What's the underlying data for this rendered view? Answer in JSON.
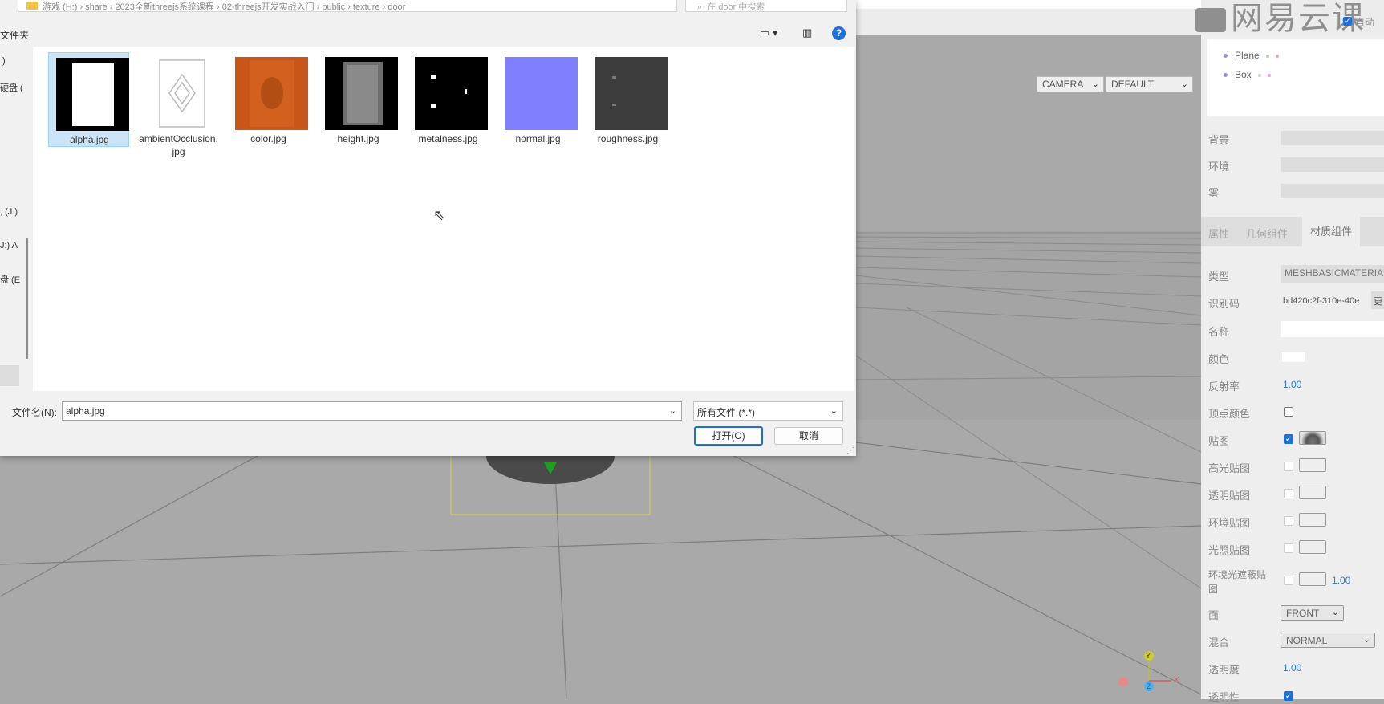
{
  "page": {
    "logo_text": "网易云课堂",
    "auto_update_label": "自动"
  },
  "viewport": {
    "camera_select": "CAMERA",
    "shading_select": "DEFAULT",
    "axis_labels": {
      "x": "X",
      "y": "Y",
      "z": "Z"
    }
  },
  "outliner": {
    "items": [
      {
        "label": "Plane"
      },
      {
        "label": "Box"
      }
    ]
  },
  "scene": {
    "background_label": "背景",
    "environment_label": "环境",
    "fog_label": "雾"
  },
  "tabs": {
    "properties": "属性",
    "geometry": "几何组件",
    "material": "材质组件"
  },
  "material": {
    "type_label": "类型",
    "type_value": "MESHBASICMATERIA",
    "uuid_label": "识别码",
    "uuid_value": "bd420c2f-310e-40e",
    "uuid_button": "更",
    "name_label": "名称",
    "color_label": "颜色",
    "color_value": "#ffffff",
    "reflectivity_label": "反射率",
    "reflectivity_value": "1.00",
    "vertex_colors_label": "顶点颜色",
    "map_label": "贴图",
    "specular_map_label": "高光贴图",
    "alpha_map_label": "透明贴图",
    "env_map_label": "环境贴图",
    "light_map_label": "光照贴图",
    "ao_map_label": "环境光遮蔽贴图",
    "ao_value": "1.00",
    "side_label": "面",
    "side_value": "FRONT",
    "blending_label": "混合",
    "blending_value": "NORMAL",
    "opacity_label": "透明度",
    "opacity_value": "1.00",
    "transparent_label": "透明性"
  },
  "dialog": {
    "path_text": "游戏 (H:) › share › 2023全新threejs系统课程 › 02-threejs开发实战入门 › public › texture › door",
    "search_placeholder": "在 door 中搜索",
    "new_folder_label": "文件夹",
    "nav_items": [
      ":)",
      "硬盘 (",
      "; (J:)",
      "J:) A",
      "盘 (E"
    ],
    "files": [
      {
        "name": "alpha.jpg",
        "thumb": "alpha"
      },
      {
        "name": "ambientOcclusion.jpg",
        "thumb": "ao"
      },
      {
        "name": "color.jpg",
        "thumb": "color"
      },
      {
        "name": "height.jpg",
        "thumb": "height"
      },
      {
        "name": "metalness.jpg",
        "thumb": "metal"
      },
      {
        "name": "normal.jpg",
        "thumb": "normal"
      },
      {
        "name": "roughness.jpg",
        "thumb": "rough"
      }
    ],
    "filename_label": "文件名(N):",
    "filename_value": "alpha.jpg",
    "filetype_value": "所有文件 (*.*)",
    "open_button": "打开(O)",
    "cancel_button": "取消"
  }
}
